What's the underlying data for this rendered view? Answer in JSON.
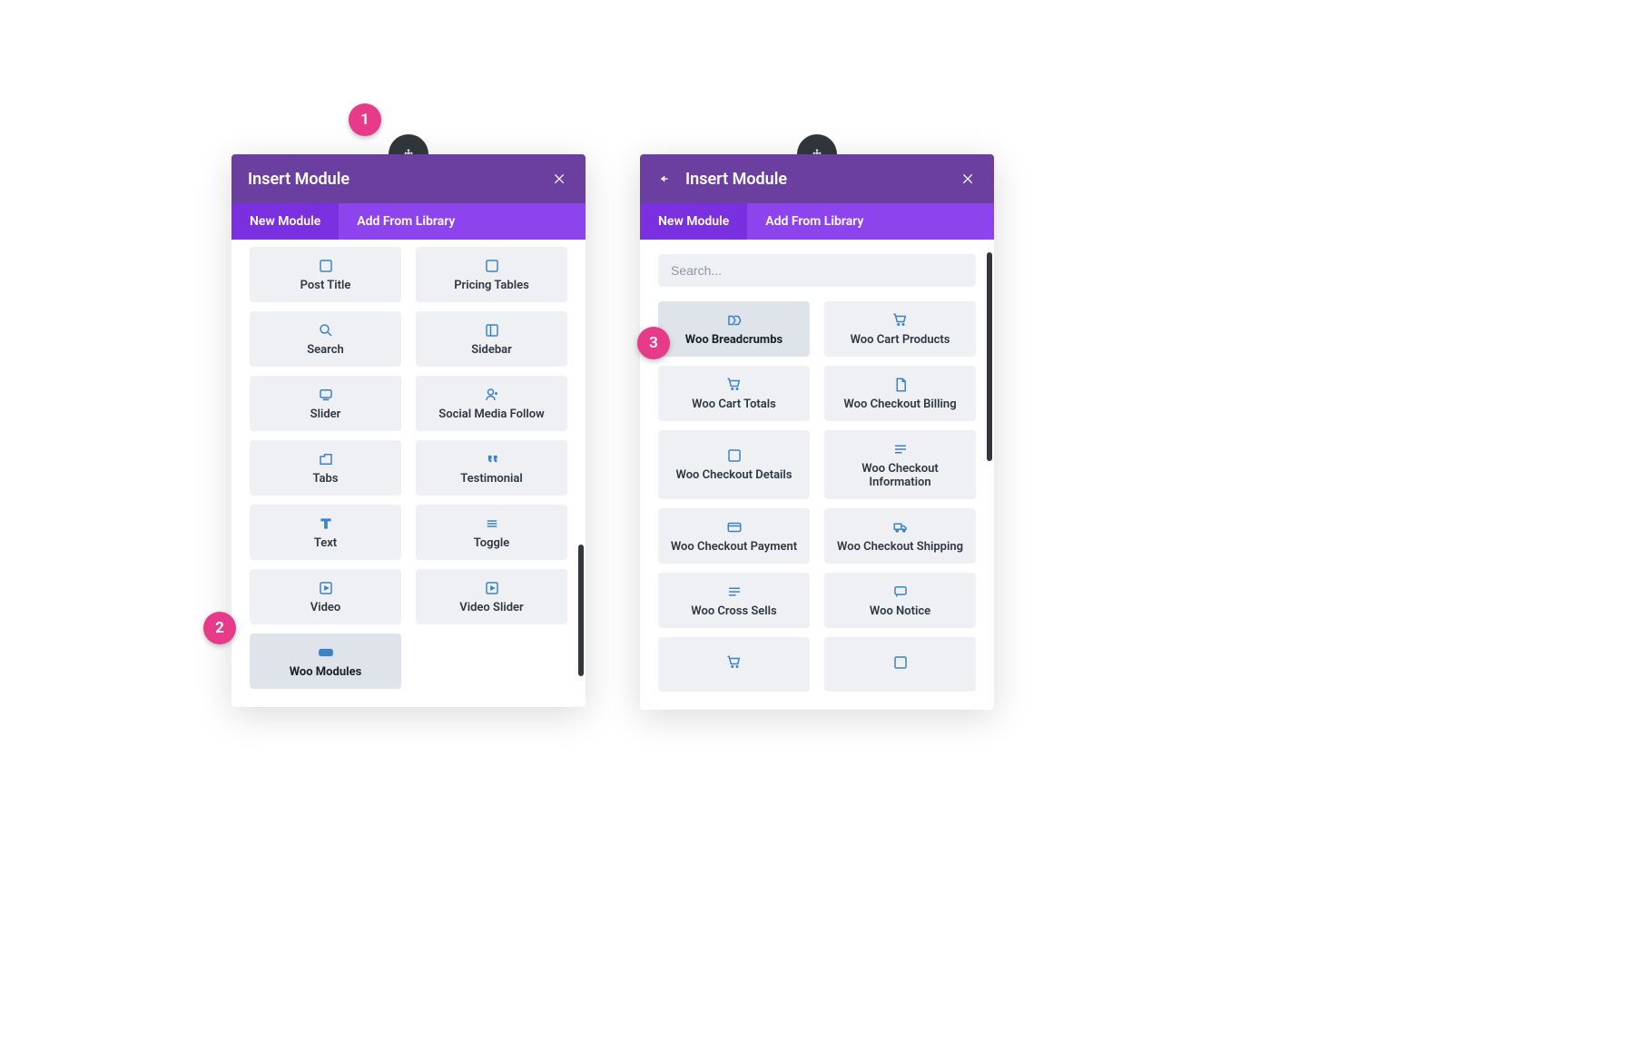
{
  "annotations": {
    "a1": "1",
    "a2": "2",
    "a3": "3"
  },
  "left_panel": {
    "title": "Insert Module",
    "tabs": {
      "new": "New Module",
      "lib": "Add From Library"
    },
    "modules": [
      {
        "label": "Post Title",
        "icon": "post-title-icon"
      },
      {
        "label": "Pricing Tables",
        "icon": "pricing-icon"
      },
      {
        "label": "Search",
        "icon": "search-icon"
      },
      {
        "label": "Sidebar",
        "icon": "sidebar-icon"
      },
      {
        "label": "Slider",
        "icon": "slider-icon"
      },
      {
        "label": "Social Media Follow",
        "icon": "social-icon"
      },
      {
        "label": "Tabs",
        "icon": "tabs-icon"
      },
      {
        "label": "Testimonial",
        "icon": "quote-icon"
      },
      {
        "label": "Text",
        "icon": "text-icon"
      },
      {
        "label": "Toggle",
        "icon": "toggle-icon"
      },
      {
        "label": "Video",
        "icon": "video-icon"
      },
      {
        "label": "Video Slider",
        "icon": "video-slider-icon"
      },
      {
        "label": "Woo Modules",
        "icon": "woo-icon",
        "hover": true
      }
    ]
  },
  "right_panel": {
    "title": "Insert Module",
    "tabs": {
      "new": "New Module",
      "lib": "Add From Library"
    },
    "search_placeholder": "Search...",
    "modules": [
      {
        "label": "Woo Breadcrumbs",
        "icon": "breadcrumbs-icon",
        "hover": true
      },
      {
        "label": "Woo Cart Products",
        "icon": "cart-icon"
      },
      {
        "label": "Woo Cart Totals",
        "icon": "cart-total-icon"
      },
      {
        "label": "Woo Checkout Billing",
        "icon": "billing-icon"
      },
      {
        "label": "Woo Checkout Details",
        "icon": "details-icon"
      },
      {
        "label": "Woo Checkout Information",
        "icon": "info-icon"
      },
      {
        "label": "Woo Checkout Payment",
        "icon": "payment-icon"
      },
      {
        "label": "Woo Checkout Shipping",
        "icon": "shipping-icon"
      },
      {
        "label": "Woo Cross Sells",
        "icon": "cross-sells-icon"
      },
      {
        "label": "Woo Notice",
        "icon": "notice-icon"
      },
      {
        "label": "",
        "icon": "cart-add-icon"
      },
      {
        "label": "",
        "icon": "product-icon"
      }
    ]
  }
}
